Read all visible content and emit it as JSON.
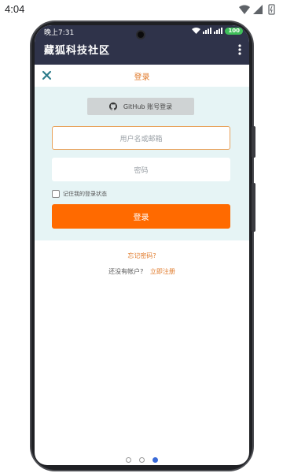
{
  "device": {
    "outer_time": "4:04"
  },
  "app": {
    "status_time": "晚上7:31",
    "battery": "100",
    "title": "藏狐科技社区"
  },
  "login": {
    "title": "登录",
    "github_button": "GitHub 账号登录",
    "username_placeholder": "用户名或邮箱",
    "password_placeholder": "密码",
    "remember_label": "记住我的登录状态",
    "remember_checked": false,
    "submit_button": "登录",
    "forgot_password": "忘记密码?",
    "no_account_prompt": "还没有帐户?",
    "register_link": "立即注册"
  },
  "pagination": {
    "dots": 3,
    "active_index": 2
  },
  "colors": {
    "toolbar": "#2f334a",
    "accent": "#ff6a00",
    "link": "#e07a2a",
    "panel": "#e6f4f5"
  }
}
